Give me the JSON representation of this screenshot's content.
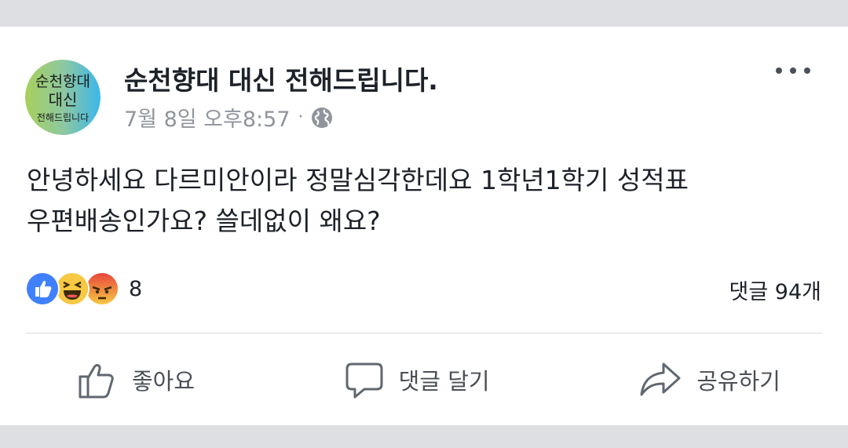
{
  "post": {
    "page_name": "순천향대 대신 전해드립니다.",
    "avatar_text": [
      "순천향대",
      "대신",
      "전해드립니다"
    ],
    "timestamp": "7월 8일 오후8:57",
    "separator": "·",
    "privacy_icon": "globe-icon",
    "text_lines": [
      "안녕하세요 다르미안이라 정말심각한데요 1학년1학기 성적표",
      "우편배송인가요? 쓸데없이 왜요?"
    ]
  },
  "reactions": {
    "icons": [
      "like-reaction-icon",
      "haha-reaction-icon",
      "angry-reaction-icon"
    ],
    "count": "8",
    "comments": "댓글 94개"
  },
  "actions": {
    "like": "좋아요",
    "comment": "댓글 달기",
    "share": "공유하기"
  },
  "colors": {
    "background": "#dddfe2",
    "card": "#ffffff",
    "like_blue": "#4080ff",
    "haha_yellow": "#f7c843",
    "angry_red": "#e9463c",
    "secondary_text": "#90949c"
  }
}
